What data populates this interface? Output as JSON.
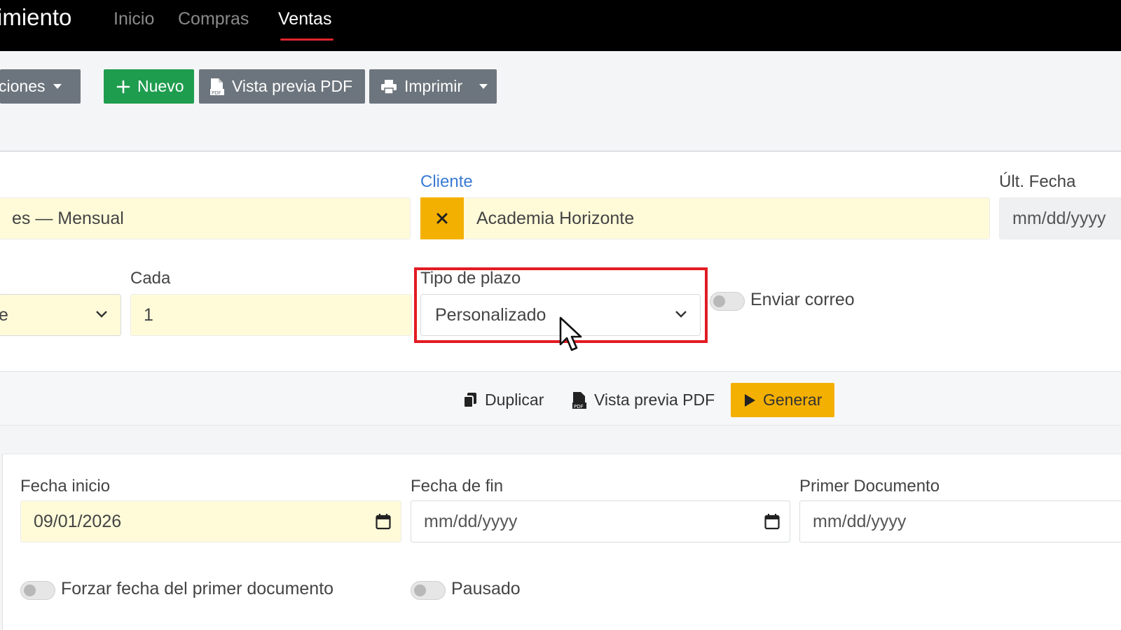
{
  "nav": {
    "brand": "imiento",
    "links": [
      {
        "label": "Inicio",
        "active": false
      },
      {
        "label": "Compras",
        "active": false
      },
      {
        "label": "Ventas",
        "active": true
      }
    ]
  },
  "toolbar": {
    "opciones_label": "ciones",
    "nuevo_label": "Nuevo",
    "pdf_label": "Vista previa PDF",
    "imprimir_label": "Imprimir"
  },
  "form": {
    "name_value": "es — Mensual",
    "cliente_label": "Cliente",
    "cliente_value": "Academia Horizonte",
    "ult_fecha_label": "Últ. Fecha",
    "ult_fecha_placeholder": "mm/dd/yyyy",
    "period_select_value": "e",
    "cada_label": "Cada",
    "cada_value": "1",
    "tipo_plazo_label": "Tipo de plazo",
    "tipo_plazo_value": "Personalizado",
    "enviar_correo_label": "Enviar correo"
  },
  "actions": {
    "duplicar_label": "Duplicar",
    "pdf_label": "Vista previa PDF",
    "generar_label": "Generar"
  },
  "schedule": {
    "fecha_inicio_label": "Fecha inicio",
    "fecha_inicio_value": "09/01/2026",
    "fecha_fin_label": "Fecha de fin",
    "fecha_fin_placeholder": "mm/dd/yyyy",
    "primer_doc_label": "Primer Documento",
    "primer_doc_placeholder": "mm/dd/yyyy",
    "forzar_label": "Forzar fecha del primer documento",
    "pausado_label": "Pausado"
  },
  "colors": {
    "accent_green": "#1f9d4f",
    "accent_yellow": "#f4b000",
    "highlight_red": "#e21b23",
    "field_yellow": "#fffbd9"
  }
}
